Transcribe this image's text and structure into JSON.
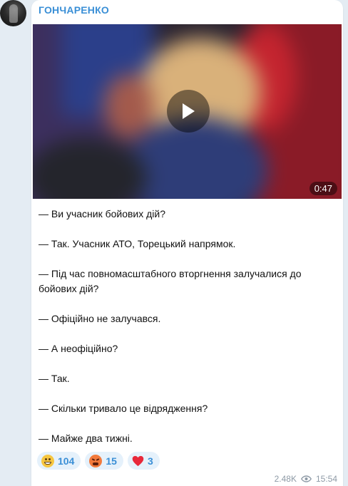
{
  "channel": {
    "name": "ГОНЧАРЕНКО"
  },
  "video": {
    "duration": "0:47"
  },
  "message": {
    "paragraphs": [
      "— Ви учасник бойових дій?",
      "— Так. Учасник АТО, Торецький напрямок.",
      "— Під час повномасштабного вторгнення залучалися до бойових дій?",
      "— Офіційно не залучався.",
      "— А неофіційно?",
      "— Так.",
      "— Скільки тривало це відрядження?",
      "— Майже два тижні."
    ]
  },
  "reactions": [
    {
      "icon": "grinning-face-icon",
      "count": "104"
    },
    {
      "icon": "angry-face-icon",
      "count": "15"
    },
    {
      "icon": "red-heart-icon",
      "count": "3"
    }
  ],
  "meta": {
    "views": "2.48K",
    "time": "15:54",
    "icon": "eye-icon"
  },
  "colors": {
    "accent": "#3a8fd6",
    "reaction_bg": "#e5f1fb",
    "page_bg": "#e4ecf3"
  }
}
